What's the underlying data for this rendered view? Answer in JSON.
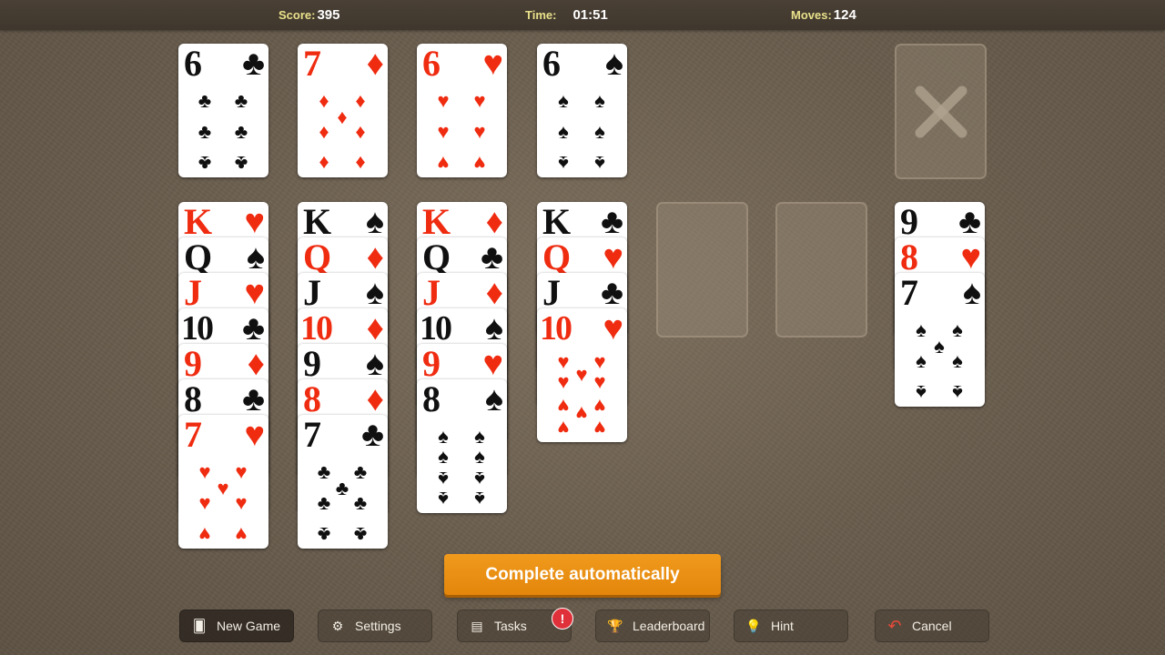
{
  "header": {
    "score_label": "Score:",
    "score_value": "395",
    "time_label": "Time:",
    "time_value": "01:51",
    "moves_label": "Moves:",
    "moves_value": "124"
  },
  "free_cells": [
    {
      "rank": "6",
      "suit": "♣",
      "color": "black",
      "count": 6
    },
    {
      "rank": "7",
      "suit": "♦",
      "color": "red",
      "count": 7
    },
    {
      "rank": "6",
      "suit": "♥",
      "color": "red",
      "count": 6
    },
    {
      "rank": "6",
      "suit": "♠",
      "color": "black",
      "count": 6
    }
  ],
  "columns": [
    {
      "cards": [
        {
          "rank": "K",
          "suit": "♥",
          "color": "red"
        },
        {
          "rank": "Q",
          "suit": "♠",
          "color": "black"
        },
        {
          "rank": "J",
          "suit": "♥",
          "color": "red"
        },
        {
          "rank": "10",
          "suit": "♣",
          "color": "black"
        },
        {
          "rank": "9",
          "suit": "♦",
          "color": "red"
        },
        {
          "rank": "8",
          "suit": "♣",
          "color": "black"
        },
        {
          "rank": "7",
          "suit": "♥",
          "color": "red"
        }
      ]
    },
    {
      "cards": [
        {
          "rank": "K",
          "suit": "♠",
          "color": "black"
        },
        {
          "rank": "Q",
          "suit": "♦",
          "color": "red"
        },
        {
          "rank": "J",
          "suit": "♠",
          "color": "black"
        },
        {
          "rank": "10",
          "suit": "♦",
          "color": "red"
        },
        {
          "rank": "9",
          "suit": "♠",
          "color": "black"
        },
        {
          "rank": "8",
          "suit": "♦",
          "color": "red"
        },
        {
          "rank": "7",
          "suit": "♣",
          "color": "black"
        }
      ]
    },
    {
      "cards": [
        {
          "rank": "K",
          "suit": "♦",
          "color": "red"
        },
        {
          "rank": "Q",
          "suit": "♣",
          "color": "black"
        },
        {
          "rank": "J",
          "suit": "♦",
          "color": "red"
        },
        {
          "rank": "10",
          "suit": "♠",
          "color": "black"
        },
        {
          "rank": "9",
          "suit": "♥",
          "color": "red"
        },
        {
          "rank": "8",
          "suit": "♠",
          "color": "black"
        }
      ]
    },
    {
      "cards": [
        {
          "rank": "K",
          "suit": "♣",
          "color": "black"
        },
        {
          "rank": "Q",
          "suit": "♥",
          "color": "red"
        },
        {
          "rank": "J",
          "suit": "♣",
          "color": "black"
        },
        {
          "rank": "10",
          "suit": "♥",
          "color": "red"
        }
      ]
    },
    {
      "cards": []
    },
    {
      "cards": []
    },
    {
      "cards": [
        {
          "rank": "9",
          "suit": "♣",
          "color": "black"
        },
        {
          "rank": "8",
          "suit": "♥",
          "color": "red"
        },
        {
          "rank": "7",
          "suit": "♠",
          "color": "black"
        }
      ]
    }
  ],
  "stock": {
    "empty": true,
    "icon": "x-icon"
  },
  "auto_button": "Complete automatically",
  "toolbar": [
    {
      "label": "New Game",
      "icon": "new-game-icon",
      "glyph": "🂠"
    },
    {
      "label": "Settings",
      "icon": "gear-icon",
      "glyph": "⚙"
    },
    {
      "label": "Tasks",
      "icon": "tasks-icon",
      "glyph": "▤"
    },
    {
      "label": "Leaderboard",
      "icon": "trophy-icon",
      "glyph": "🏆"
    },
    {
      "label": "Hint",
      "icon": "lightbulb-icon",
      "glyph": "💡"
    },
    {
      "label": "Cancel",
      "icon": "undo-icon",
      "glyph": "↶"
    }
  ],
  "tasks_badge": "!"
}
